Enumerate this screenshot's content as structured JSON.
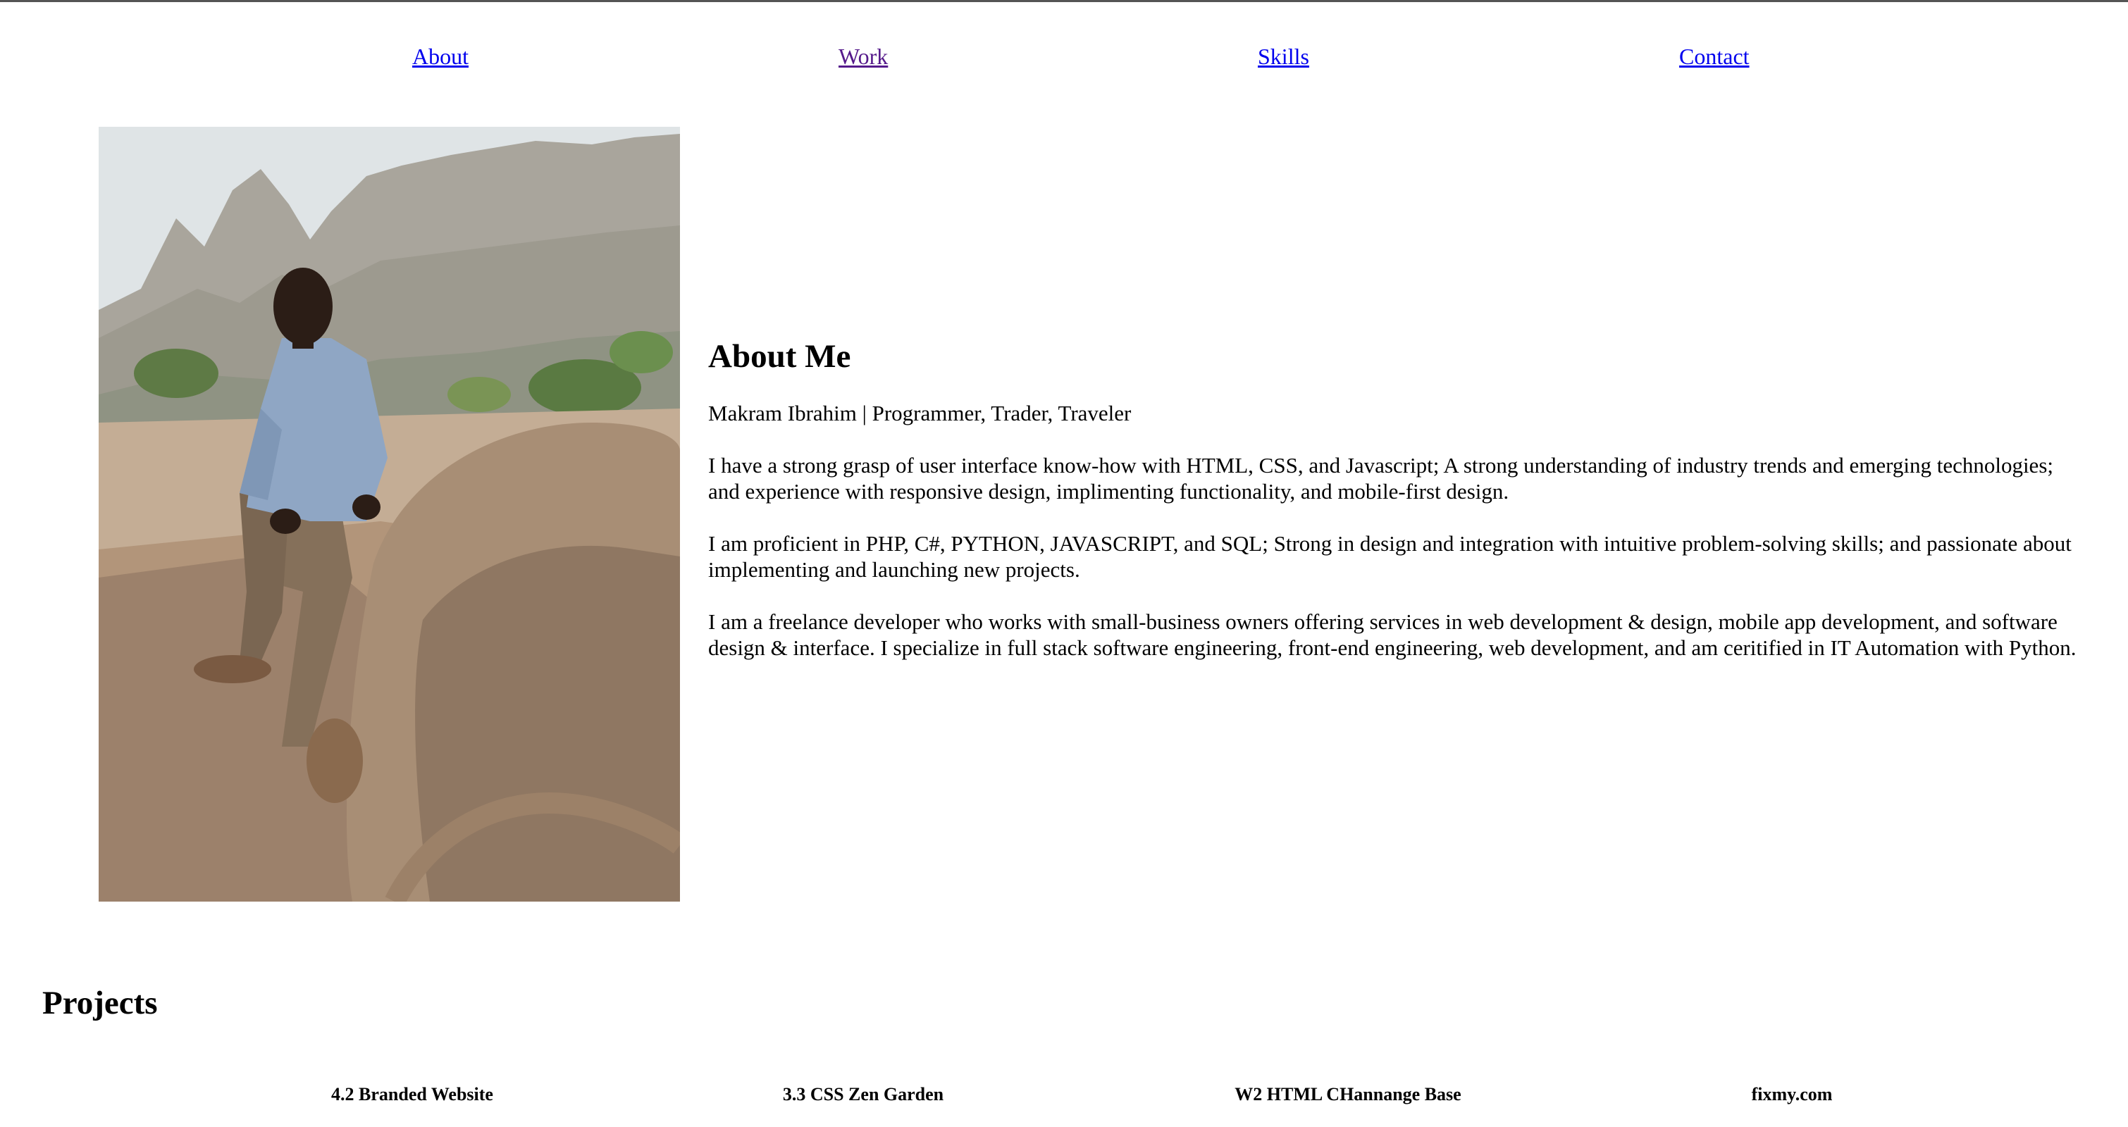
{
  "nav": {
    "items": [
      {
        "label": "About",
        "state": "link"
      },
      {
        "label": "Work",
        "state": "visited"
      },
      {
        "label": "Skills",
        "state": "link"
      },
      {
        "label": "Contact",
        "state": "link"
      }
    ]
  },
  "about": {
    "heading": "About Me",
    "tagline": "Makram Ibrahim | Programmer, Trader, Traveler",
    "paragraphs": [
      "I have a strong grasp of user interface know-how with HTML, CSS, and Javascript; A strong understanding of industry trends and emerging technologies; and experience with responsive design, implimenting functionality, and mobile-first design.",
      "I am proficient in PHP, C#, PYTHON, JAVASCRIPT, and SQL; Strong in design and integration with intuitive problem-solving skills; and passionate about implementing and launching new projects.",
      "I am a freelance developer who works with small-business owners offering services in web development & design, mobile app development, and software design & interface. I specialize in full stack software engineering, front-end engineering, web development, and am ceritified in IT Automation with Python."
    ]
  },
  "projects": {
    "heading": "Projects",
    "items": [
      "4.2 Branded Website",
      "3.3 CSS Zen Garden",
      "W2 HTML CHannange Base",
      "fixmy.com"
    ]
  },
  "colors": {
    "link": "#0000ee",
    "visited": "#551a8b",
    "text": "#000000",
    "background": "#ffffff"
  }
}
